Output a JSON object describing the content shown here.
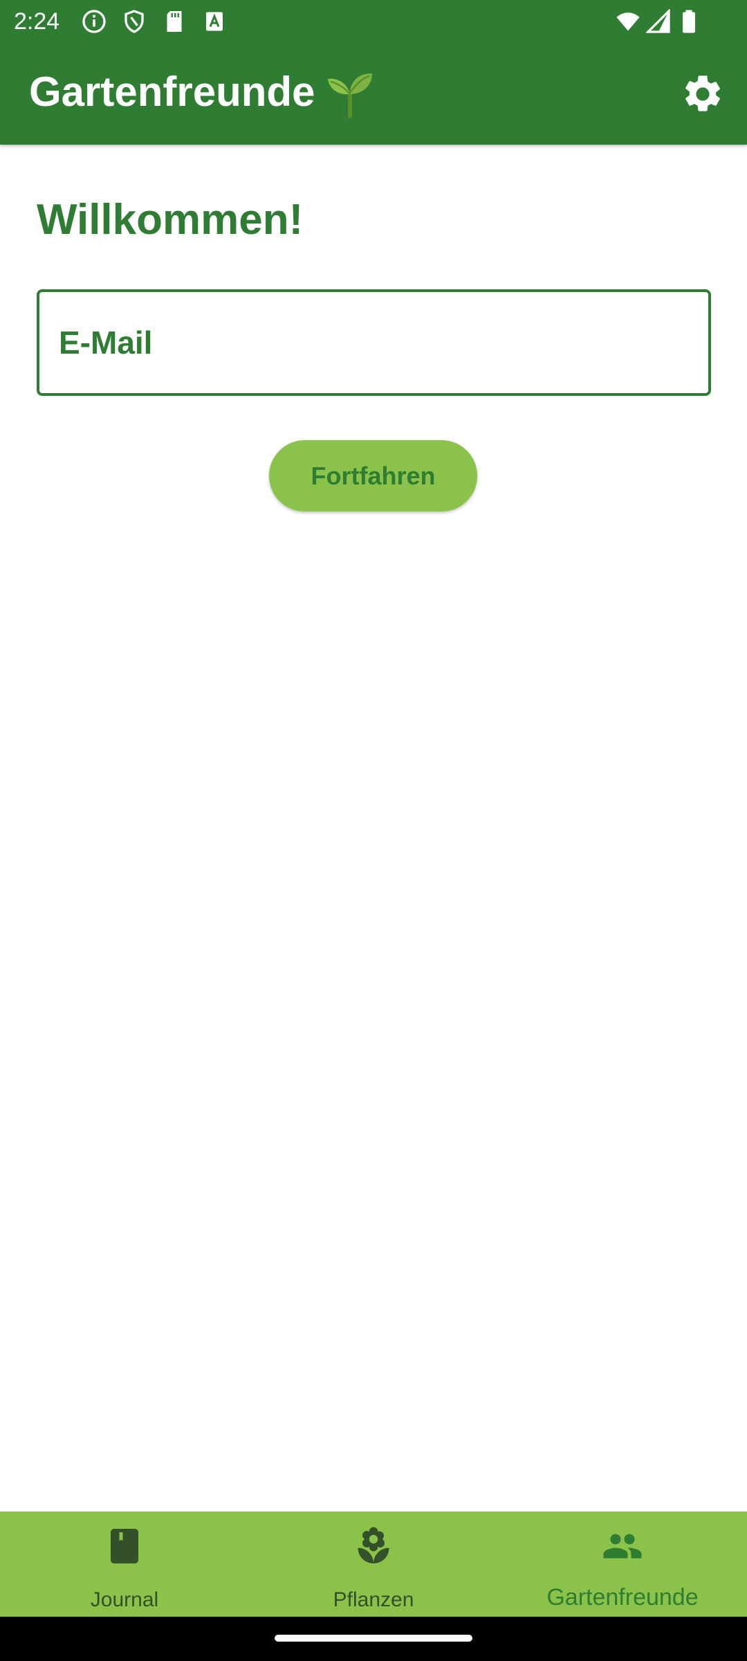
{
  "status_bar": {
    "time": "2:24",
    "icons": [
      "info-icon",
      "shield-icon",
      "sd-card-icon",
      "a-badge-icon",
      "wifi-icon",
      "signal-icon",
      "battery-icon"
    ]
  },
  "app_bar": {
    "title": "Gartenfreunde",
    "title_icon": "seedling-icon",
    "settings_icon": "gear-icon"
  },
  "main": {
    "heading": "Willkommen!",
    "email_placeholder": "E-Mail",
    "email_value": "",
    "continue_label": "Fortfahren"
  },
  "bottom_nav": {
    "items": [
      {
        "label": "Journal",
        "icon": "book-icon",
        "active": false
      },
      {
        "label": "Pflanzen",
        "icon": "flower-icon",
        "active": false
      },
      {
        "label": "Gartenfreunde",
        "icon": "people-icon",
        "active": true
      }
    ]
  },
  "colors": {
    "primary": "#2e7d32",
    "accent": "#8bc34a",
    "background": "#ffffff"
  }
}
